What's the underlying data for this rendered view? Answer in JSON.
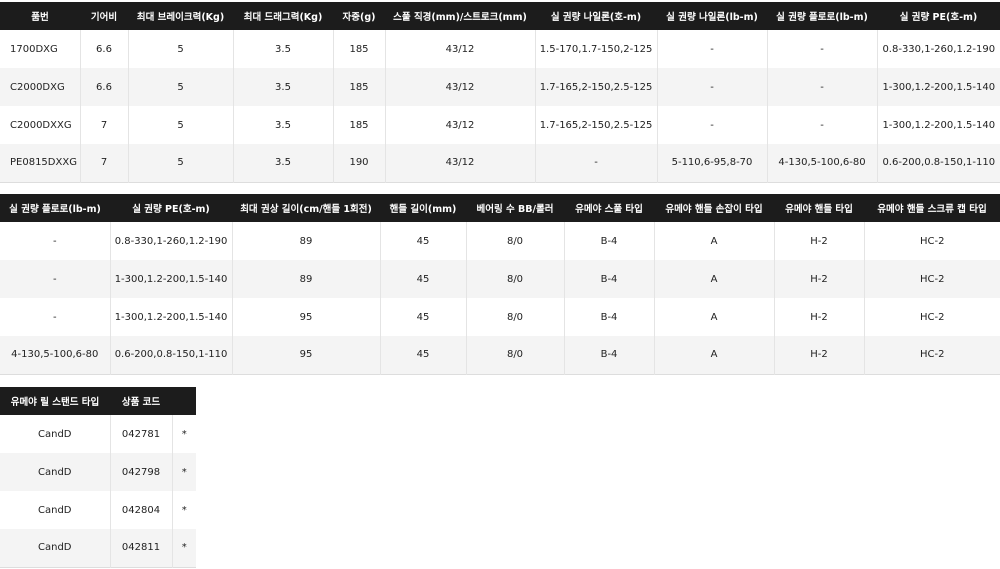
{
  "table1": {
    "headers": [
      "품번",
      "기어비",
      "최대 브레이크력(Kg)",
      "최대 드래그력(Kg)",
      "자중(g)",
      "스풀 직경(mm)/스트로크(mm)",
      "실 권량 나일론(호-m)",
      "실 권량 나일론(lb-m)",
      "실 권량 플로로(lb-m)",
      "실 권량 PE(호-m)"
    ],
    "rows": [
      [
        "1700DXG",
        "6.6",
        "5",
        "3.5",
        "185",
        "43/12",
        "1.5-170,1.7-150,2-125",
        "-",
        "-",
        "0.8-330,1-260,1.2-190"
      ],
      [
        "C2000DXG",
        "6.6",
        "5",
        "3.5",
        "185",
        "43/12",
        "1.7-165,2-150,2.5-125",
        "-",
        "-",
        "1-300,1.2-200,1.5-140"
      ],
      [
        "C2000DXXG",
        "7",
        "5",
        "3.5",
        "185",
        "43/12",
        "1.7-165,2-150,2.5-125",
        "-",
        "-",
        "1-300,1.2-200,1.5-140"
      ],
      [
        "PE0815DXXG",
        "7",
        "5",
        "3.5",
        "190",
        "43/12",
        "-",
        "5-110,6-95,8-70",
        "4-130,5-100,6-80",
        "0.6-200,0.8-150,1-110"
      ]
    ]
  },
  "table2": {
    "headers": [
      "실 권량 플로로(lb-m)",
      "실 권량 PE(호-m)",
      "최대 권상 길이(cm/핸들 1회전)",
      "핸들 길이(mm)",
      "베어링 수 BB/롤러",
      "유메야 스풀 타입",
      "유메야 핸들 손잡이 타입",
      "유메야 핸들 타입",
      "유메야 핸들 스크류 캡 타입"
    ],
    "rows": [
      [
        "-",
        "0.8-330,1-260,1.2-190",
        "89",
        "45",
        "8/0",
        "B-4",
        "A",
        "H-2",
        "HC-2"
      ],
      [
        "-",
        "1-300,1.2-200,1.5-140",
        "89",
        "45",
        "8/0",
        "B-4",
        "A",
        "H-2",
        "HC-2"
      ],
      [
        "-",
        "1-300,1.2-200,1.5-140",
        "95",
        "45",
        "8/0",
        "B-4",
        "A",
        "H-2",
        "HC-2"
      ],
      [
        "4-130,5-100,6-80",
        "0.6-200,0.8-150,1-110",
        "95",
        "45",
        "8/0",
        "B-4",
        "A",
        "H-2",
        "HC-2"
      ]
    ]
  },
  "table3": {
    "headers": [
      "유메야 릴 스탠드 타입",
      "상품 코드",
      ""
    ],
    "rows": [
      [
        "CandD",
        "042781",
        "*"
      ],
      [
        "CandD",
        "042798",
        "*"
      ],
      [
        "CandD",
        "042804",
        "*"
      ],
      [
        "CandD",
        "042811",
        "*"
      ]
    ]
  }
}
